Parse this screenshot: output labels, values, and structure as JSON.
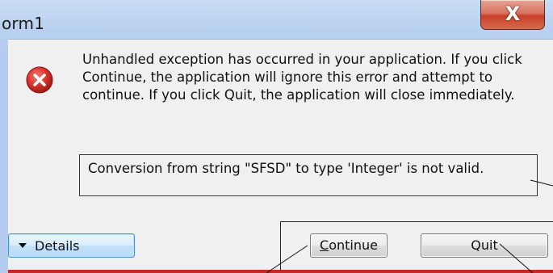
{
  "window": {
    "title": "orm1",
    "close_glyph": "X"
  },
  "dialog": {
    "icon": "error-icon",
    "message": "Unhandled exception has occurred in your application. If you click Continue, the application will ignore this error and attempt to continue. If you click Quit, the application will close immediately.",
    "detail": "Conversion from string \"SFSD\" to type 'Integer' is not valid."
  },
  "buttons": {
    "details_label": "Details",
    "continue_first": "C",
    "continue_rest": "ontinue",
    "quit_label": "Quit"
  },
  "colors": {
    "error_red": "#d8302b",
    "frame_blue": "#b7d0ef",
    "close_red": "#c7402b",
    "bottom_line": "#c62727"
  }
}
